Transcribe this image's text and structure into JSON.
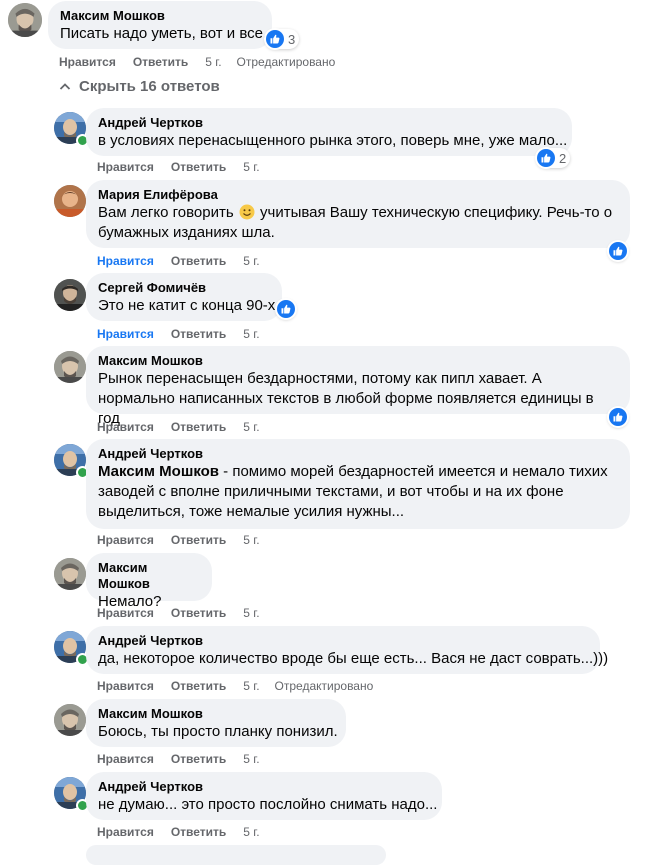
{
  "top_comment": {
    "author": "Максим Мошков",
    "text": "Писать надо уметь, вот и все.",
    "reaction_count": "3",
    "actions": {
      "like": "Нравится",
      "reply": "Ответить",
      "time": "5 г.",
      "edited": "Отредактировано"
    }
  },
  "hide_replies_label": "Скрыть 16 ответов",
  "replies": [
    {
      "author": "Андрей Чертков",
      "text": "в условиях перенасыщенного рынка этого, поверь мне, уже мало...",
      "reaction_count": "2",
      "actions": {
        "like": "Нравится",
        "reply": "Ответить",
        "time": "5 г."
      }
    },
    {
      "author": "Мария Елифёрова",
      "text_part1": "Вам легко говорить",
      "text_part2": "учитывая Вашу техническую специфику. Речь-то о бумажных изданиях шла.",
      "actions": {
        "like": "Нравится",
        "reply": "Ответить",
        "time": "5 г."
      }
    },
    {
      "author": "Сергей Фомичёв",
      "text": "Это не катит с конца 90-х",
      "actions": {
        "like": "Нравится",
        "reply": "Ответить",
        "time": "5 г."
      }
    },
    {
      "author": "Максим Мошков",
      "text": "Рынок перенасыщен бездарностями, потому как пипл хавает. А нормально написанных текстов в любой форме появляется единицы в год",
      "actions": {
        "like": "Нравится",
        "reply": "Ответить",
        "time": "5 г."
      }
    },
    {
      "author": "Андрей Чертков",
      "mention": "Максим Мошков",
      "text": " - помимо морей бездарностей имеется и немало тихих заводей с вполне приличными текстами, и вот чтобы и на их фоне выделиться, тоже немалые усилия нужны...",
      "actions": {
        "like": "Нравится",
        "reply": "Ответить",
        "time": "5 г."
      }
    },
    {
      "author": "Максим Мошков",
      "text": "Немало?",
      "actions": {
        "like": "Нравится",
        "reply": "Ответить",
        "time": "5 г."
      }
    },
    {
      "author": "Андрей Чертков",
      "text": "да, некоторое количество вроде бы еще есть... Вася не даст соврать...)))",
      "actions": {
        "like": "Нравится",
        "reply": "Ответить",
        "time": "5 г.",
        "edited": "Отредактировано"
      }
    },
    {
      "author": "Максим Мошков",
      "text": "Боюсь, ты просто планку понизил.",
      "actions": {
        "like": "Нравится",
        "reply": "Ответить",
        "time": "5 г."
      }
    },
    {
      "author": "Андрей Чертков",
      "text": "не думаю... это просто послойно снимать надо...",
      "actions": {
        "like": "Нравится",
        "reply": "Ответить",
        "time": "5 г."
      }
    }
  ],
  "colors": {
    "like_blue": "#1877f2",
    "bubble_bg": "#f0f2f5",
    "meta_gray": "#65676b",
    "online_green": "#31a24c"
  },
  "icons": {
    "reaction": "like-thumb-icon",
    "emoji": "smiling-face-emoji",
    "collapse": "chevron-up-icon"
  }
}
